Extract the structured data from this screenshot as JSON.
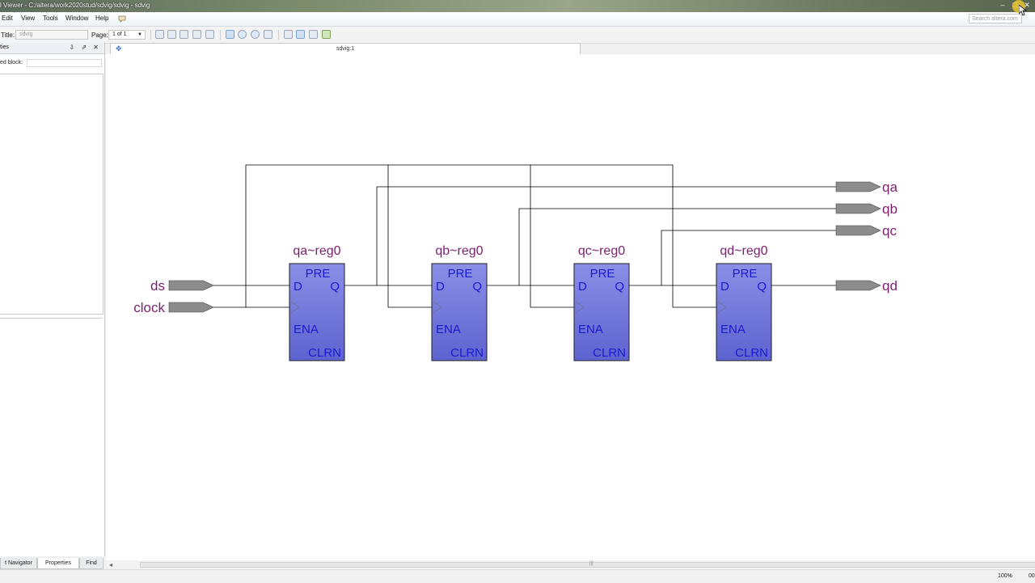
{
  "window": {
    "title": "l Viewer - C:/altera/work2020stud/sdvig/sdvig - sdvig",
    "minimize": "–",
    "maximize": "□",
    "close": "✕"
  },
  "menu": {
    "items": [
      "Edit",
      "View",
      "Tools",
      "Window",
      "Help"
    ],
    "search_placeholder": "Search altera.com"
  },
  "toolbar": {
    "title_label": "Title:",
    "title_value": "sdvig",
    "page_label": "Page:",
    "page_value": "1 of 1"
  },
  "left_panel": {
    "title": "ties",
    "field_label": "ed block:",
    "controls": "⇩ ⇗ ✕"
  },
  "bottom_tabs": [
    "t Navigator",
    "Properties",
    "Find"
  ],
  "doc_tab": {
    "name": "sdvig:1"
  },
  "status": {
    "zoom": "100%",
    "extra": "00"
  },
  "schematic": {
    "inputs": [
      "ds",
      "clock"
    ],
    "outputs": [
      "qa",
      "qb",
      "qc",
      "qd"
    ],
    "registers": [
      {
        "name": "qa~reg0",
        "pre": "PRE",
        "d": "D",
        "q": "Q",
        "ena": "ENA",
        "clrn": "CLRN"
      },
      {
        "name": "qb~reg0",
        "pre": "PRE",
        "d": "D",
        "q": "Q",
        "ena": "ENA",
        "clrn": "CLRN"
      },
      {
        "name": "qc~reg0",
        "pre": "PRE",
        "d": "D",
        "q": "Q",
        "ena": "ENA",
        "clrn": "CLRN"
      },
      {
        "name": "qd~reg0",
        "pre": "PRE",
        "d": "D",
        "q": "Q",
        "ena": "ENA",
        "clrn": "CLRN"
      }
    ],
    "colors": {
      "port_fill": "#8c8c8c",
      "reg_fill": "#6d73d6",
      "label": "#7a1e6e",
      "pin_text": "#1b1bd0",
      "wire": "#000000"
    }
  }
}
